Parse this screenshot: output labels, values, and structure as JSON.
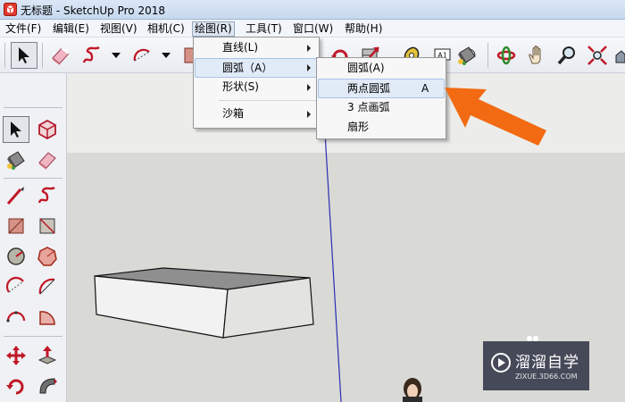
{
  "window": {
    "title": "无标题 - SketchUp Pro 2018"
  },
  "menubar": {
    "items": [
      {
        "label": "文件(F)"
      },
      {
        "label": "编辑(E)"
      },
      {
        "label": "视图(V)"
      },
      {
        "label": "相机(C)"
      },
      {
        "label": "绘图(R)",
        "active": true
      },
      {
        "label": "工具(T)"
      },
      {
        "label": "窗口(W)"
      },
      {
        "label": "帮助(H)"
      }
    ]
  },
  "draw_menu": {
    "items": [
      {
        "label": "直线(L)",
        "submenu": true
      },
      {
        "label": "圆弧（A）",
        "submenu": true,
        "open": true
      },
      {
        "label": "形状(S)",
        "submenu": true
      },
      {
        "label": "沙箱",
        "submenu": true
      }
    ]
  },
  "arc_submenu": {
    "items": [
      {
        "label": "圆弧(A)",
        "accelerator": ""
      },
      {
        "label": "两点圆弧",
        "accelerator": "A",
        "highlighted": true
      },
      {
        "label": "3 点画弧",
        "accelerator": ""
      },
      {
        "label": "扇形",
        "accelerator": ""
      }
    ]
  },
  "toolbar": {
    "text_tool_label": "A1",
    "icons": [
      "select-arrow-icon",
      "eraser-icon",
      "freehand-icon",
      "arc-icon",
      "rotate-icon",
      "move-icon",
      "tape-measure-icon",
      "text-icon",
      "paint-bucket-icon",
      "orbit-icon",
      "pan-hand-icon",
      "zoom-icon",
      "zoom-extents-icon"
    ]
  },
  "palette": {
    "icons": [
      "select-arrow-icon",
      "make-component-icon",
      "paint-bucket-icon",
      "eraser-icon",
      "line-icon",
      "freehand-icon",
      "rectangle-icon",
      "rotated-rectangle-icon",
      "circle-icon",
      "polygon-icon",
      "arc-icon",
      "two-point-arc-icon",
      "three-point-arc-icon",
      "pie-icon",
      "move-icon",
      "push-pull-icon",
      "rotate-icon",
      "follow-me-icon"
    ]
  },
  "watermark": {
    "title": "溜溜自学",
    "subtitle": "ZIXUE.3D66.COM"
  },
  "colors": {
    "highlight": "#e1ebf8",
    "callout_arrow": "#f26a12",
    "canvas_ground": "#d9d9d6",
    "canvas_sky": "#ececea",
    "axis_blue": "#2a2fb4"
  }
}
